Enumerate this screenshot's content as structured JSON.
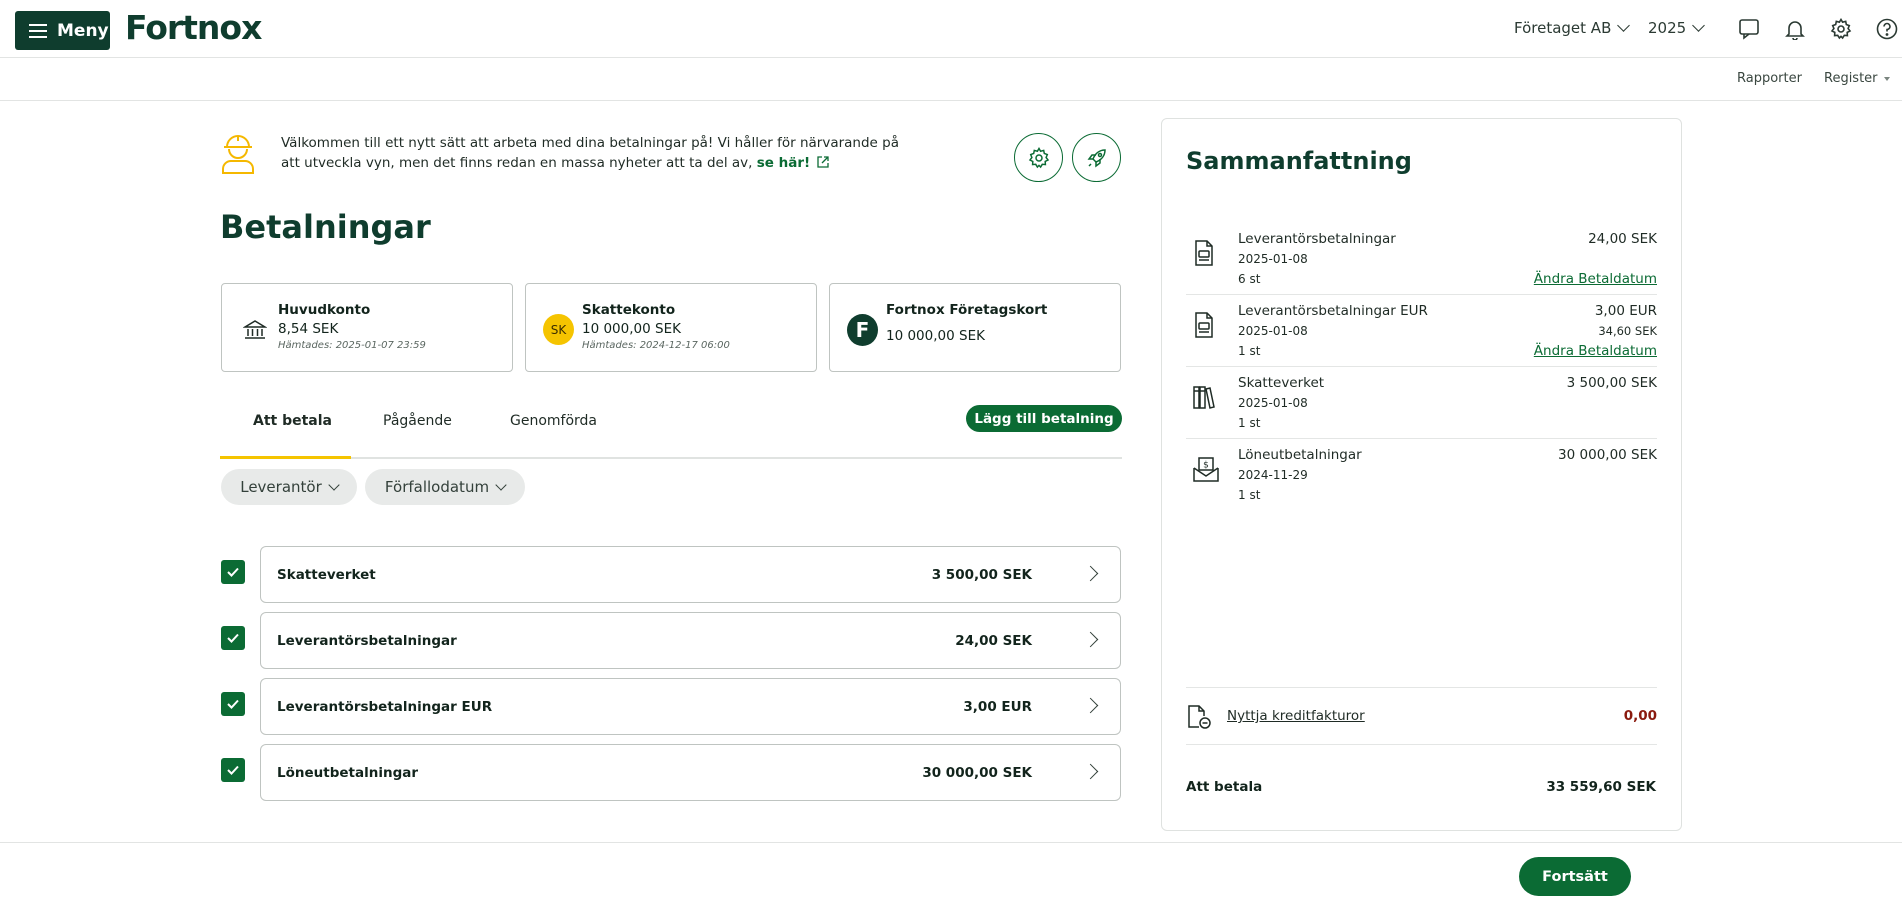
{
  "header": {
    "menu_label": "Meny",
    "logo_text": "Fortnox",
    "company": "Företaget AB",
    "year": "2025",
    "icons": [
      "chat-icon",
      "bell-icon",
      "gear-icon",
      "help-icon"
    ]
  },
  "subnav": {
    "reports": "Rapporter",
    "register": "Register"
  },
  "banner": {
    "text": "Välkommen till ett nytt sätt att arbeta med dina betalningar på! Vi håller för närvarande på att utveckla vyn, men det finns redan en massa nyheter att ta del av,",
    "link": "se här!"
  },
  "page_title": "Betalningar",
  "accounts": [
    {
      "name": "Huvudkonto",
      "amount": "8,54 SEK",
      "fetched": "Hämtades: 2025-01-07 23:59",
      "icon": "bank-icon"
    },
    {
      "name": "Skattekonto",
      "amount": "10 000,00 SEK",
      "fetched": "Hämtades: 2024-12-17 06:00",
      "badge": "SK"
    },
    {
      "name": "Fortnox Företagskort",
      "amount": "10 000,00 SEK",
      "badge": "F"
    }
  ],
  "tabs": [
    "Att betala",
    "Pågående",
    "Genomförda"
  ],
  "add_payment_label": "Lägg till betalning",
  "filters": [
    "Leverantör",
    "Förfallodatum"
  ],
  "payments": [
    {
      "name": "Skatteverket",
      "amount": "3 500,00 SEK",
      "checked": true
    },
    {
      "name": "Leverantörsbetalningar",
      "amount": "24,00 SEK",
      "checked": true
    },
    {
      "name": "Leverantörsbetalningar EUR",
      "amount": "3,00 EUR",
      "checked": true
    },
    {
      "name": "Löneutbetalningar",
      "amount": "30 000,00 SEK",
      "checked": true
    }
  ],
  "summary": {
    "title": "Sammanfattning",
    "items": [
      {
        "name": "Leverantörsbetalningar",
        "date": "2025-01-08",
        "count": "6 st",
        "amount": "24,00 SEK",
        "link": "Ändra Betaldatum",
        "icon": "invoice-icon"
      },
      {
        "name": "Leverantörsbetalningar EUR",
        "date": "2025-01-08",
        "count": "1 st",
        "amount": "3,00 EUR",
        "amount_sek": "34,60 SEK",
        "link": "Ändra Betaldatum",
        "icon": "invoice-icon"
      },
      {
        "name": "Skatteverket",
        "date": "2025-01-08",
        "count": "1 st",
        "amount": "3 500,00 SEK",
        "icon": "books-icon"
      },
      {
        "name": "Löneutbetalningar",
        "date": "2024-11-29",
        "count": "1 st",
        "amount": "30 000,00 SEK",
        "icon": "salary-icon"
      }
    ],
    "credit_label": "Nyttja kreditfakturor",
    "credit_value": "0,00",
    "total_label": "Att betala",
    "total_value": "33 559,60 SEK"
  },
  "continue_label": "Fortsätt",
  "colors": {
    "brand_dark": "#0f3d2e",
    "brand_green": "#0b6b34",
    "accent_yellow": "#f5c400",
    "negative": "#8a1a0e"
  }
}
